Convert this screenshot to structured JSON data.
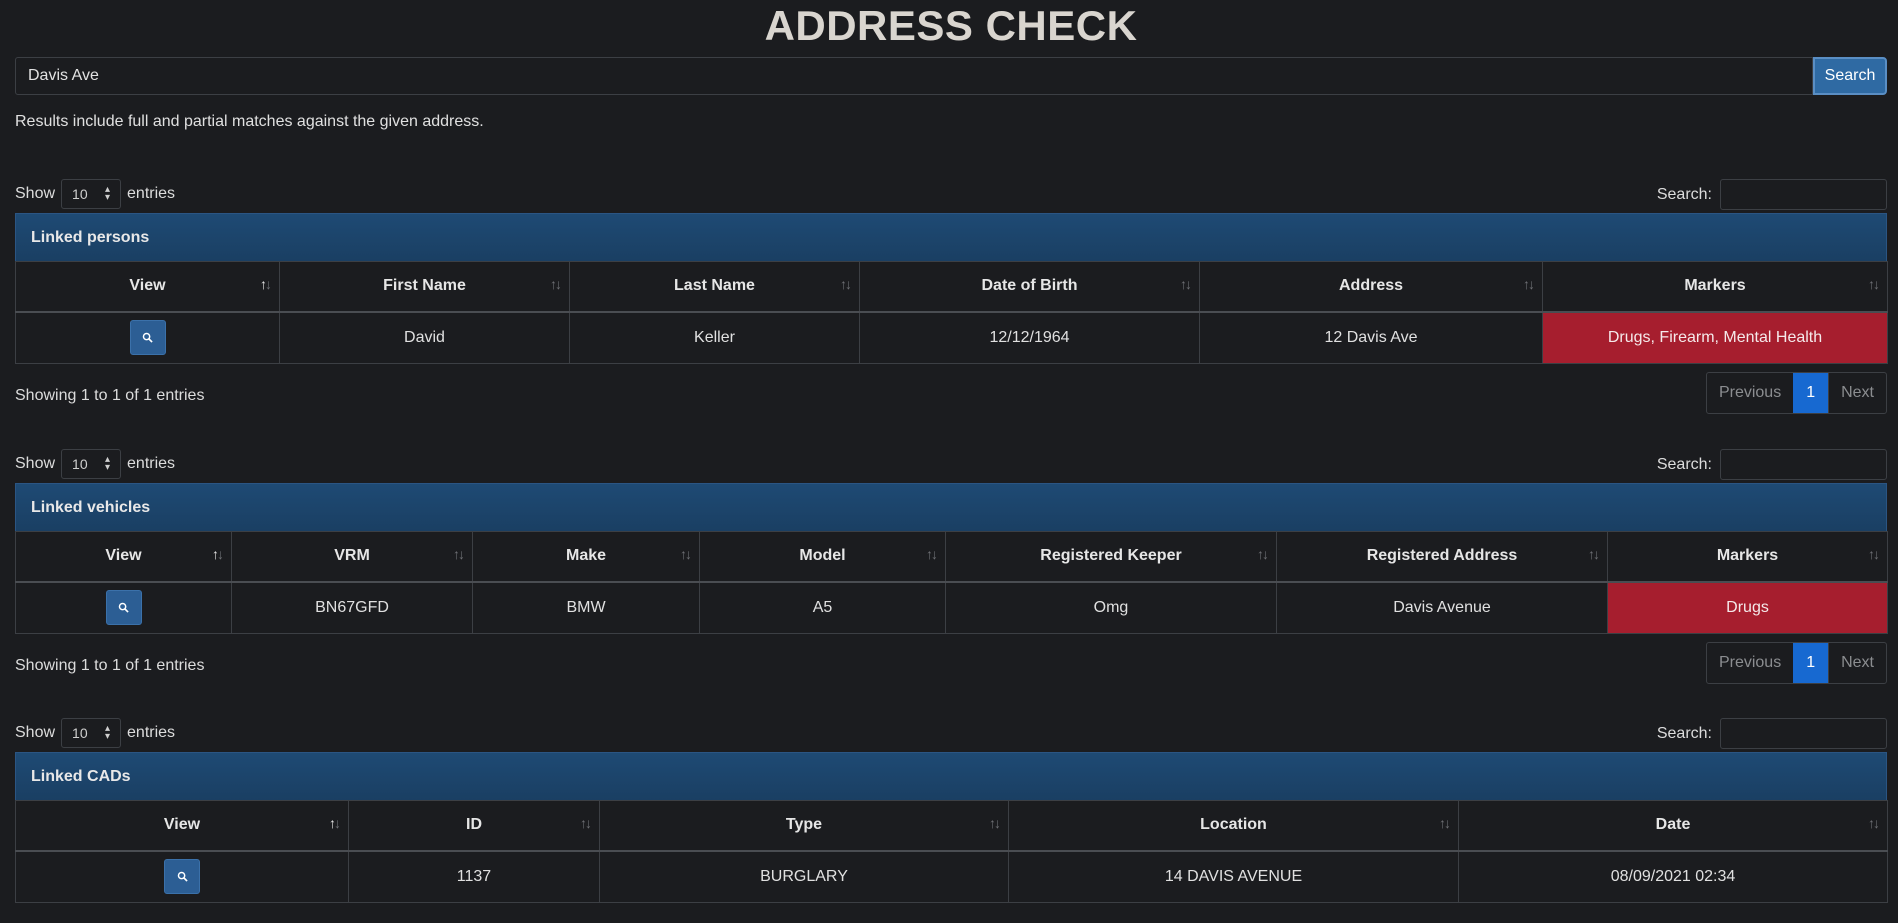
{
  "page": {
    "title": "ADDRESS CHECK",
    "search_value": "Davis Ave",
    "search_button": "Search",
    "note": "Results include full and partial matches against the given address."
  },
  "common": {
    "show": "Show",
    "entries": "entries",
    "length_value": "10",
    "search_label": "Search:",
    "info": "Showing 1 to 1 of 1 entries",
    "previous": "Previous",
    "page": "1",
    "next": "Next"
  },
  "persons": {
    "caption": "Linked persons",
    "headers": [
      "View",
      "First Name",
      "Last Name",
      "Date of Birth",
      "Address",
      "Markers"
    ],
    "rows": [
      {
        "first_name": "David",
        "last_name": "Keller",
        "dob": "12/12/1964",
        "address": "12 Davis Ave",
        "markers": "Drugs, Firearm, Mental Health"
      }
    ]
  },
  "vehicles": {
    "caption": "Linked vehicles",
    "headers": [
      "View",
      "VRM",
      "Make",
      "Model",
      "Registered Keeper",
      "Registered Address",
      "Markers"
    ],
    "rows": [
      {
        "vrm": "BN67GFD",
        "make": "BMW",
        "model": "A5",
        "keeper": "Omg",
        "address": "Davis Avenue",
        "markers": "Drugs"
      }
    ]
  },
  "cads": {
    "caption": "Linked CADs",
    "headers": [
      "View",
      "ID",
      "Type",
      "Location",
      "Date"
    ],
    "rows": [
      {
        "id": "1137",
        "type": "BURGLARY",
        "location": "14 DAVIS AVENUE",
        "date": "08/09/2021 02:34"
      }
    ]
  },
  "colors": {
    "background": "#1b1c1f",
    "caption": "#1e4a74",
    "marker": "#a61e2e",
    "view_button": "#2c5e94",
    "page_active": "#1769d1"
  },
  "icons": {
    "view": "search-icon",
    "sort": "sort-arrows-icon"
  }
}
